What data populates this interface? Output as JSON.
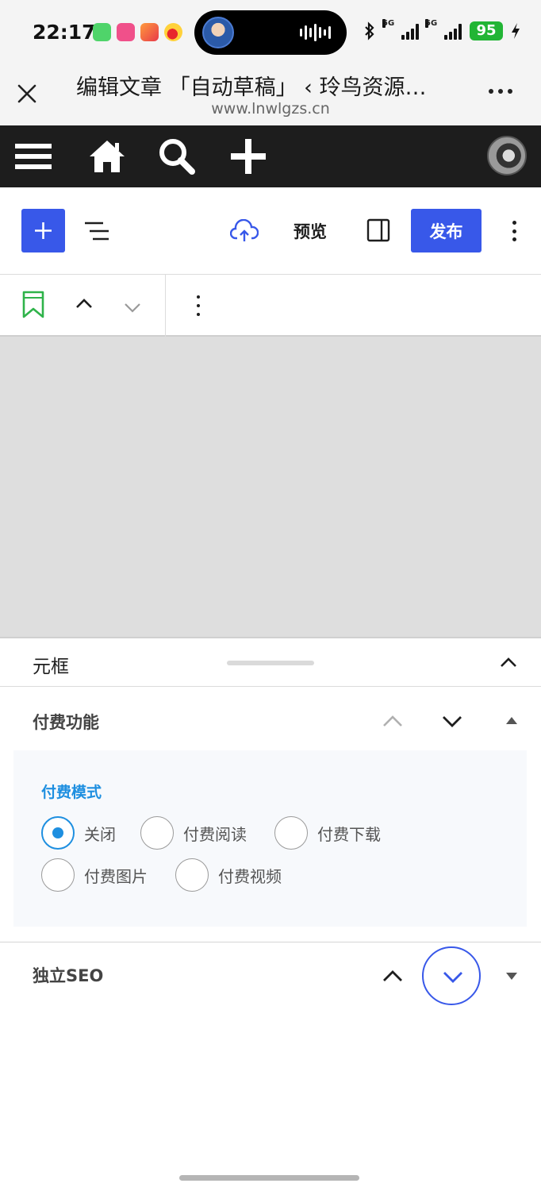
{
  "status_bar": {
    "time": "22:17",
    "app_icons": [
      "messages-icon",
      "lofter-icon",
      "game-icon",
      "weibo-icon"
    ],
    "signal_label_1": "5G",
    "signal_label_2": "5G",
    "battery": "95"
  },
  "browser": {
    "title": "编辑文章 「自动草稿」 ‹ 玲鸟资源…",
    "url": "www.lnwlgzs.cn"
  },
  "admin_bar": {
    "icons": [
      "menu-icon",
      "home-icon",
      "search-icon",
      "add-icon",
      "avatar"
    ]
  },
  "toolbar": {
    "inserter": "add-block-icon",
    "preview_label": "预览",
    "publish_label": "发布"
  },
  "meta": {
    "title": "元框"
  },
  "pay_panel": {
    "title": "付费功能",
    "mode_label": "付费模式",
    "options": [
      {
        "label": "关闭",
        "checked": true
      },
      {
        "label": "付费阅读",
        "checked": false
      },
      {
        "label": "付费下载",
        "checked": false
      },
      {
        "label": "付费图片",
        "checked": false
      },
      {
        "label": "付费视频",
        "checked": false
      }
    ]
  },
  "seo_panel": {
    "title": "独立SEO"
  },
  "colors": {
    "accent": "#3858e9",
    "radio_checked": "#1e8fe0",
    "admin_bar": "#1d1d1d",
    "battery": "#22b535"
  }
}
